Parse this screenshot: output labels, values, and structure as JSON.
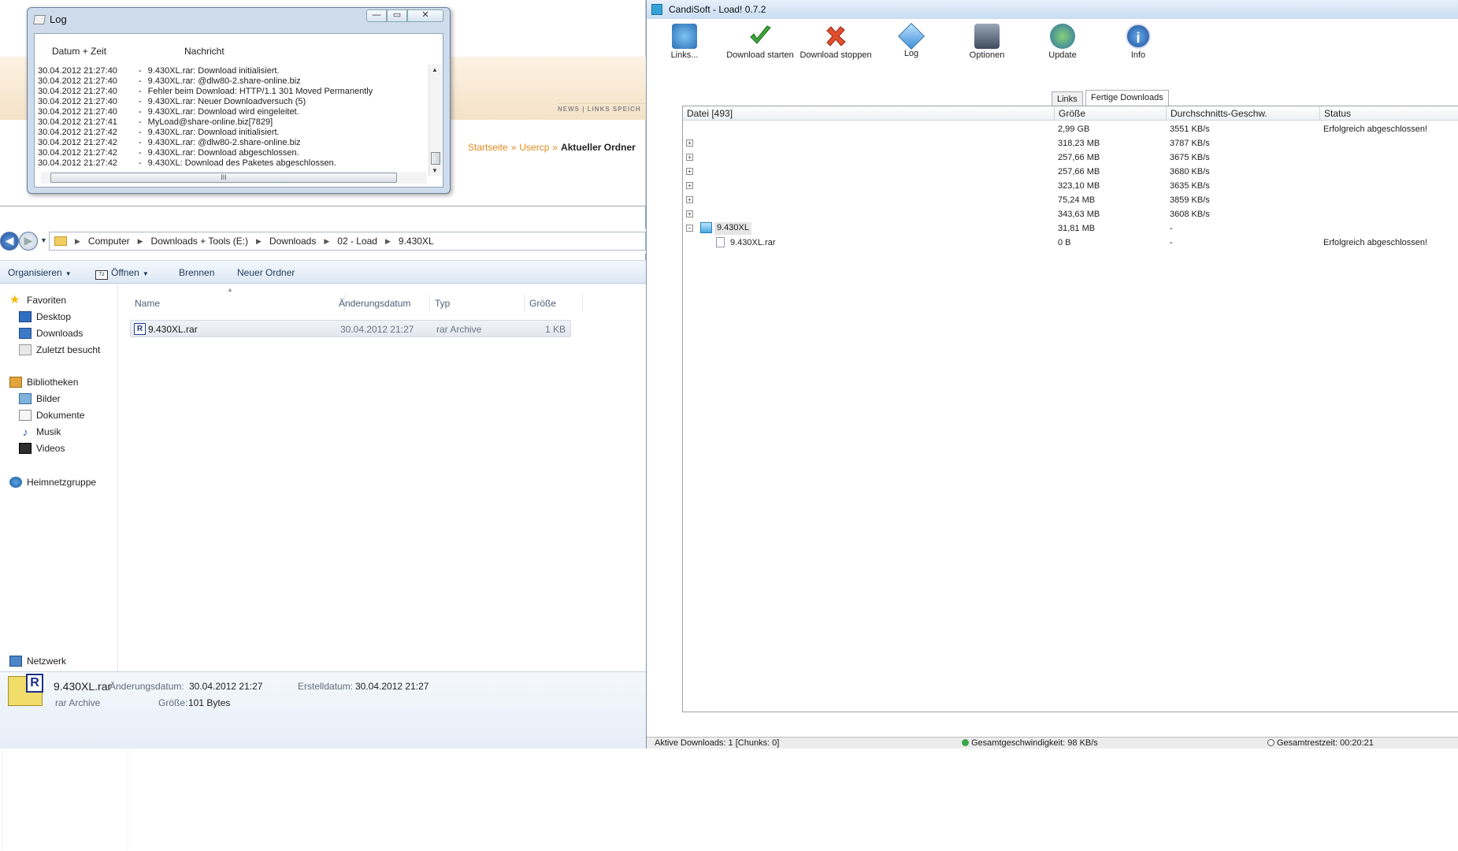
{
  "browser": {
    "nav_text": "NEWS | LINKS SPEICH",
    "breadcrumb": {
      "home": "Startseite",
      "sep": "»",
      "usercp": "Usercp",
      "current": "Aktueller Ordner"
    }
  },
  "log_window": {
    "title": "Log",
    "columns": {
      "time": "Datum + Zeit",
      "message": "Nachricht"
    },
    "rows": [
      {
        "time": "30.04.2012 21:27:40",
        "msg": "9.430XL.rar: Download initialisiert."
      },
      {
        "time": "30.04.2012 21:27:40",
        "msg": "9.430XL.rar: @dlw80-2.share-online.biz"
      },
      {
        "time": "30.04.2012 21:27:40",
        "msg": "Fehler beim Download: HTTP/1.1 301 Moved Permanently"
      },
      {
        "time": "30.04.2012 21:27:40",
        "msg": "9.430XL.rar: Neuer Downloadversuch (5)"
      },
      {
        "time": "30.04.2012 21:27:40",
        "msg": "9.430XL.rar: Download wird eingeleitet."
      },
      {
        "time": "30.04.2012 21:27:41",
        "msg": "MyLoad@share-online.biz[7829]"
      },
      {
        "time": "30.04.2012 21:27:42",
        "msg": "9.430XL.rar: Download initialisiert."
      },
      {
        "time": "30.04.2012 21:27:42",
        "msg": "9.430XL.rar: @dlw80-2.share-online.biz"
      },
      {
        "time": "30.04.2012 21:27:42",
        "msg": "9.430XL.rar: Download abgeschlossen."
      },
      {
        "time": "30.04.2012 21:27:42",
        "msg": "9.430XL: Download des Paketes abgeschlossen."
      }
    ],
    "row_dash": "-",
    "scroll_grip": "III",
    "btn_min": "—",
    "btn_max": "▭",
    "btn_close": "✕"
  },
  "explorer": {
    "path": [
      "Computer",
      "Downloads + Tools (E:)",
      "Downloads",
      "02 - Load",
      "9.430XL"
    ],
    "toolbar": {
      "organize": "Organisieren",
      "open": "Öffnen",
      "burn": "Brennen",
      "new_folder": "Neuer Ordner",
      "open_icon_text": "7z"
    },
    "nav": {
      "favorites": "Favoriten",
      "desktop": "Desktop",
      "downloads": "Downloads",
      "recent": "Zuletzt besucht",
      "libraries": "Bibliotheken",
      "pictures": "Bilder",
      "documents": "Dokumente",
      "music": "Musik",
      "videos": "Videos",
      "homegroup": "Heimnetzgruppe",
      "network": "Netzwerk"
    },
    "columns": {
      "name": "Name",
      "modified": "Änderungsdatum",
      "type": "Typ",
      "size": "Größe"
    },
    "files": [
      {
        "name": "9.430XL.rar",
        "modified": "30.04.2012 21:27",
        "type": "rar Archive",
        "size": "1 KB"
      }
    ],
    "details": {
      "filename": "9.430XL.rar",
      "modified_label": "Änderungsdatum:",
      "modified_value": "30.04.2012 21:27",
      "created_label": "Erstelldatum:",
      "created_value": "30.04.2012 21:27",
      "type": "rar Archive",
      "size_label": "Größe:",
      "size_value": "101 Bytes",
      "icon_letter": "R"
    }
  },
  "load_window": {
    "title": "CandiSoft - Load! 0.7.2",
    "toolbar": {
      "links": "Links...",
      "start": "Download starten",
      "stop": "Download stoppen",
      "log": "Log",
      "options": "Optionen",
      "update": "Update",
      "info": "Info"
    },
    "tabs": {
      "links": "Links",
      "done": "Fertige Downloads"
    },
    "columns": {
      "file": "Datei [493]",
      "size": "Größe",
      "speed": "Durchschnitts-Geschw.",
      "status": "Status"
    },
    "rows": [
      {
        "expander": "",
        "name": "",
        "size": "2,99 GB",
        "speed": "3551 KB/s",
        "status": "Erfolgreich abgeschlossen!"
      },
      {
        "expander": "+",
        "name": "",
        "size": "318,23 MB",
        "speed": "3787 KB/s",
        "status": ""
      },
      {
        "expander": "+",
        "name": "",
        "size": "257,66 MB",
        "speed": "3675 KB/s",
        "status": ""
      },
      {
        "expander": "+",
        "name": "",
        "size": "257,66 MB",
        "speed": "3680 KB/s",
        "status": ""
      },
      {
        "expander": "+",
        "name": "",
        "size": "323,10 MB",
        "speed": "3635 KB/s",
        "status": ""
      },
      {
        "expander": "+",
        "name": "",
        "size": "75,24 MB",
        "speed": "3859 KB/s",
        "status": ""
      },
      {
        "expander": "+",
        "name": "",
        "size": "343,63 MB",
        "speed": "3608 KB/s",
        "status": ""
      }
    ],
    "package": {
      "expander": "−",
      "name": "9.430XL",
      "size": "31,81 MB",
      "speed": "-",
      "status": ""
    },
    "child": {
      "name": "9.430XL.rar",
      "size": "0 B",
      "speed": "-",
      "status": "Erfolgreich abgeschlossen!"
    },
    "status_bar": {
      "active": "Aktive Downloads: 1 [Chunks: 0]",
      "speed": "Gesamtgeschwindigkeit: 98 KB/s",
      "remaining": "Gesamtrestzeit: 00:20:21"
    },
    "info_glyph": "i"
  }
}
